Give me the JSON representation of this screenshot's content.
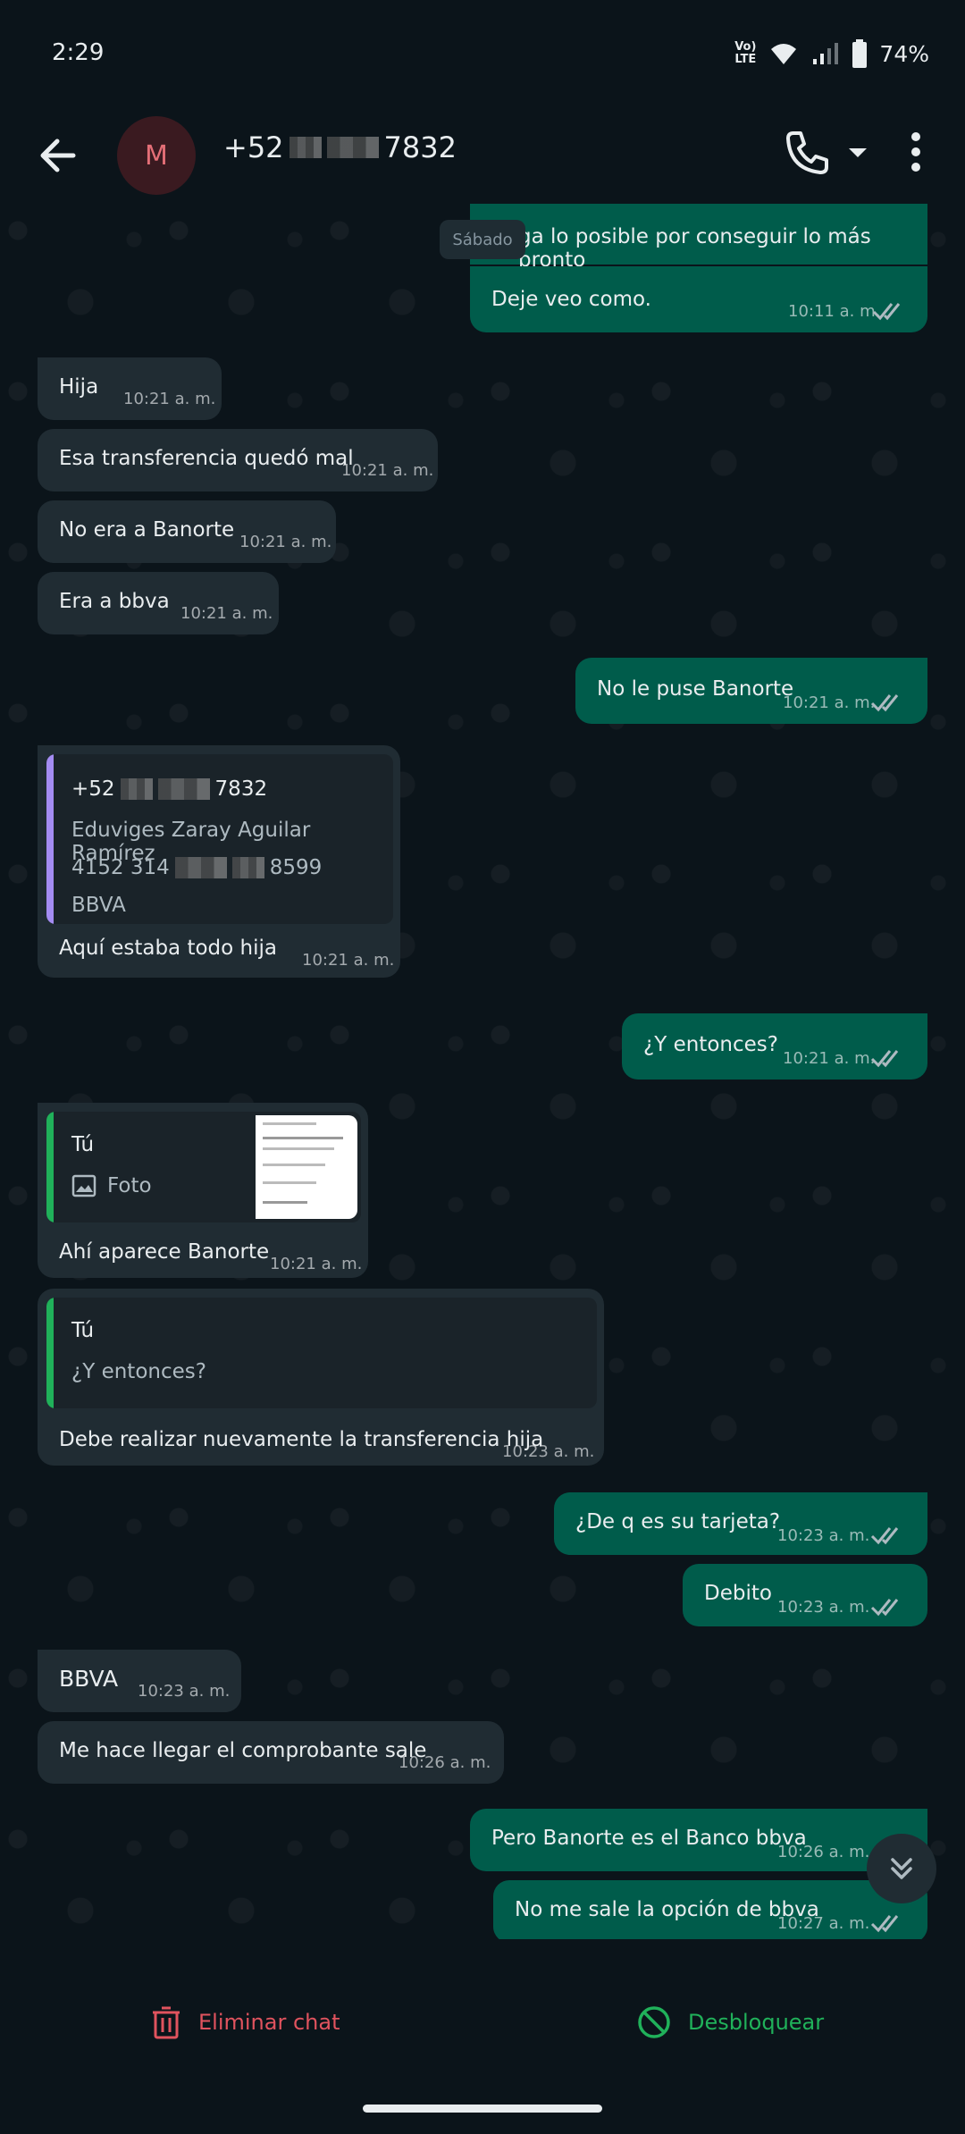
{
  "status_bar": {
    "time": "2:29",
    "volte_top": "Vo)",
    "volte_bottom": "LTE",
    "battery": "74%"
  },
  "header": {
    "avatar_letter": "M",
    "contact_prefix": "+52",
    "contact_suffix": "7832"
  },
  "chat": {
    "day_label": "Sábado",
    "messages": [
      {
        "text": "ga lo posible por conseguir lo más pronto"
      },
      {
        "text": "Deje veo como.",
        "time": "10:11 a. m."
      },
      {
        "text": "Hija",
        "time": "10:21 a. m."
      },
      {
        "text": "Esa transferencia quedó mal",
        "time": "10:21 a. m."
      },
      {
        "text": "No era a Banorte",
        "time": "10:21 a. m."
      },
      {
        "text": "Era a bbva",
        "time": "10:21 a. m."
      },
      {
        "text": "No le puse Banorte",
        "time": "10:21 a. m."
      },
      {
        "quote_lines": [
          "+52",
          "7832",
          "Eduviges Zaray Aguilar Ramírez",
          "4152 314",
          "8599",
          "BBVA"
        ],
        "text": "Aquí estaba todo hija",
        "time": "10:21 a. m."
      },
      {
        "text": "¿Y entonces?",
        "time": "10:21 a. m."
      },
      {
        "quote_sender": "Tú",
        "quote_text": "Foto",
        "text": "Ahí aparece Banorte",
        "time": "10:21 a. m."
      },
      {
        "quote_sender": "Tú",
        "quote_text": "¿Y entonces?",
        "text": "Debe realizar nuevamente la transferencia hija",
        "time": "10:23 a. m."
      },
      {
        "text": "¿De q es su tarjeta?",
        "time": "10:23 a. m."
      },
      {
        "text": "Debito",
        "time": "10:23 a. m."
      },
      {
        "text": "BBVA",
        "time": "10:23 a. m."
      },
      {
        "text": "Me hace llegar el comprobante sale",
        "time": "10:26 a. m."
      },
      {
        "text": "Pero Banorte es el Banco bbva",
        "time": "10:26 a. m."
      },
      {
        "text": "No me sale la opción de bbva",
        "time": "10:27 a. m."
      }
    ]
  },
  "bottom_bar": {
    "delete_label": "Eliminar chat",
    "unblock_label": "Desbloquear"
  },
  "colors": {
    "outgoing": "#005c4b",
    "incoming": "#202c33",
    "danger": "#e0535e",
    "success": "#20b15a",
    "quote_purple": "#a48cf2",
    "quote_green": "#20b15a"
  }
}
